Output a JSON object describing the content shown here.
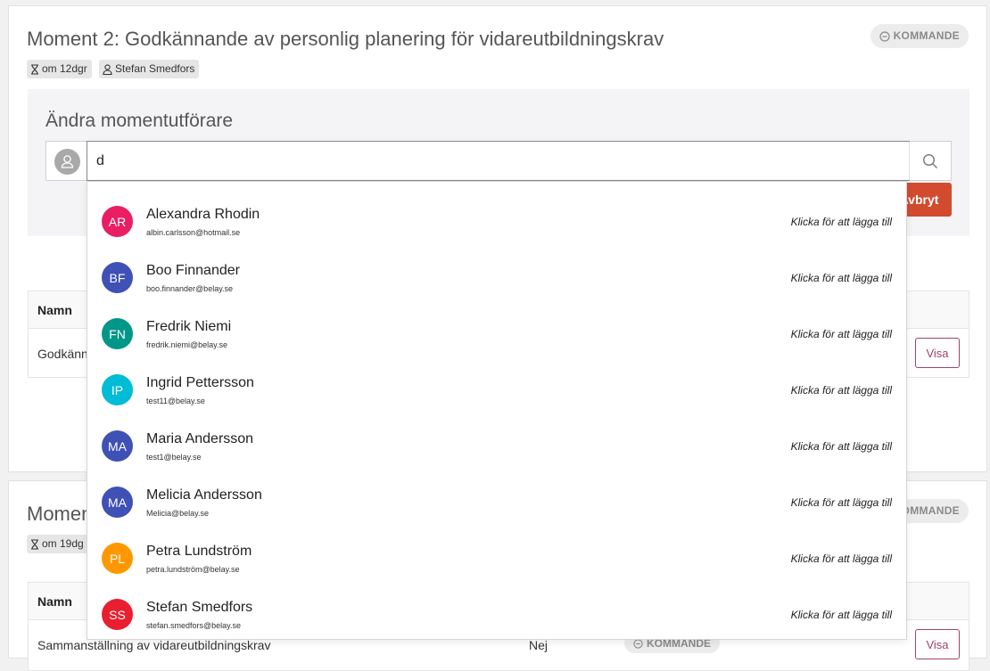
{
  "moment2": {
    "title": "Moment 2: Godkännande av personlig planering för vidareutbildningskrav",
    "status": "KOMMANDE",
    "due": "om 12dgr",
    "owner": "Stefan Smedfors",
    "edit": {
      "title": "Ändra momentutförare",
      "search_value": "d",
      "cancel_label": "Avbryt"
    },
    "table": {
      "col_name": "Namn",
      "row_name": "Godkänn",
      "view_label": "Visa"
    }
  },
  "moment3": {
    "title": "Momen",
    "status": "KOMMANDE",
    "due": "om 19dg",
    "table": {
      "col_name": "Namn",
      "row_name": "Sammanställning av vidareutbildningskrav",
      "row_value": "Nej",
      "row_status": "KOMMANDE",
      "view_label": "Visa"
    }
  },
  "dropdown": {
    "action_label": "Klicka för att lägga till",
    "items": [
      {
        "initials": "AR",
        "name": "Alexandra Rhodin",
        "email": "albin.carlsson@hotmail.se",
        "color": "#e91e63"
      },
      {
        "initials": "BF",
        "name": "Boo Finnander",
        "email": "boo.finnander@belay.se",
        "color": "#3f51b5"
      },
      {
        "initials": "FN",
        "name": "Fredrik Niemi",
        "email": "fredrik.niemi@belay.se",
        "color": "#009688"
      },
      {
        "initials": "IP",
        "name": "Ingrid Pettersson",
        "email": "test11@belay.se",
        "color": "#00bcd4"
      },
      {
        "initials": "MA",
        "name": "Maria Andersson",
        "email": "test1@belay.se",
        "color": "#3f51b5"
      },
      {
        "initials": "MA",
        "name": "Melicia Andersson",
        "email": "Melicia@belay.se",
        "color": "#3f51b5"
      },
      {
        "initials": "PL",
        "name": "Petra Lundström",
        "email": "petra.lundström@belay.se",
        "color": "#ff9800"
      },
      {
        "initials": "SS",
        "name": "Stefan Smedfors",
        "email": "stefan.smedfors@belay.se",
        "color": "#e91e2f"
      }
    ]
  }
}
